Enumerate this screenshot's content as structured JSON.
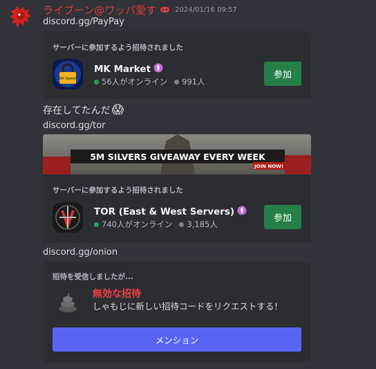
{
  "message": {
    "username": "ライブーン@ワッパ愛す",
    "timestamp": "2024/01/16 09:57",
    "link1": "discord.gg/PayPay",
    "text": "存在してたんだ",
    "emoji": "😱",
    "link2": "discord.gg/tor",
    "link3": "discord.gg/onion"
  },
  "invite1": {
    "title": "サーバーに参加するよう招待されました",
    "server_name": "MK Market",
    "icon_label": "MK Market",
    "online": "56人がオンライン",
    "members": "991人",
    "join_label": "参加"
  },
  "invite2": {
    "banner_text": "5M SILVERS GIVEAWAY EVERY WEEK",
    "banner_cta": "JOIN NOW!",
    "title": "サーバーに参加するよう招待されました",
    "server_name": "TOR (East & West Servers)",
    "online": "740人がオンライン",
    "members": "3,185人",
    "join_label": "参加"
  },
  "invite3": {
    "title": "招待を受信しましたが...",
    "invalid_title": "無効な招待",
    "invalid_sub": "しゃもじに新しい招待コードをリクエストする！",
    "mention_label": "メンション"
  },
  "colors": {
    "background": "#313338",
    "card": "#2b2d31",
    "username": "#e03c3c",
    "join_button": "#248046",
    "mention_button": "#5865f2",
    "invalid": "#f23f43",
    "online_dot": "#23a55a"
  }
}
